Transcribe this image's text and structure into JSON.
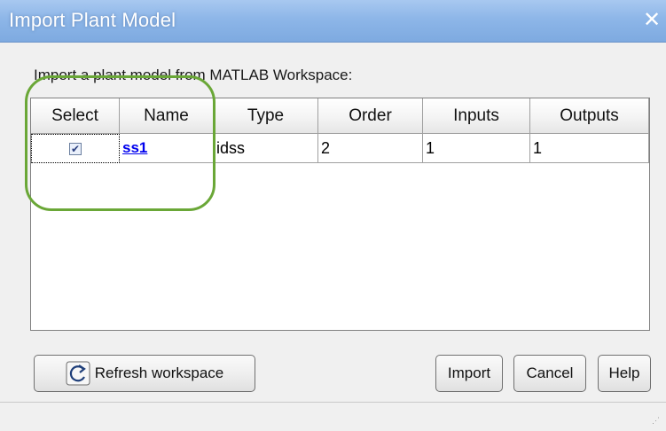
{
  "window": {
    "title": "Import Plant Model",
    "close_glyph": "✕"
  },
  "prompt": "Import a plant model from MATLAB Workspace:",
  "table": {
    "columns": [
      "Select",
      "Name",
      "Type",
      "Order",
      "Inputs",
      "Outputs"
    ],
    "rows": [
      {
        "selected": true,
        "name": "ss1",
        "type": "idss",
        "order": "2",
        "inputs": "1",
        "outputs": "1"
      }
    ]
  },
  "buttons": {
    "refresh": "Refresh workspace",
    "import": "Import",
    "cancel": "Cancel",
    "help": "Help"
  },
  "icons": {
    "refresh": "refresh-icon",
    "checkbox": "checkmark-icon",
    "close": "close-icon"
  },
  "colors": {
    "title_gradient": "#8db6e8",
    "highlight_ring": "#6aa737",
    "link": "#0000ee"
  }
}
